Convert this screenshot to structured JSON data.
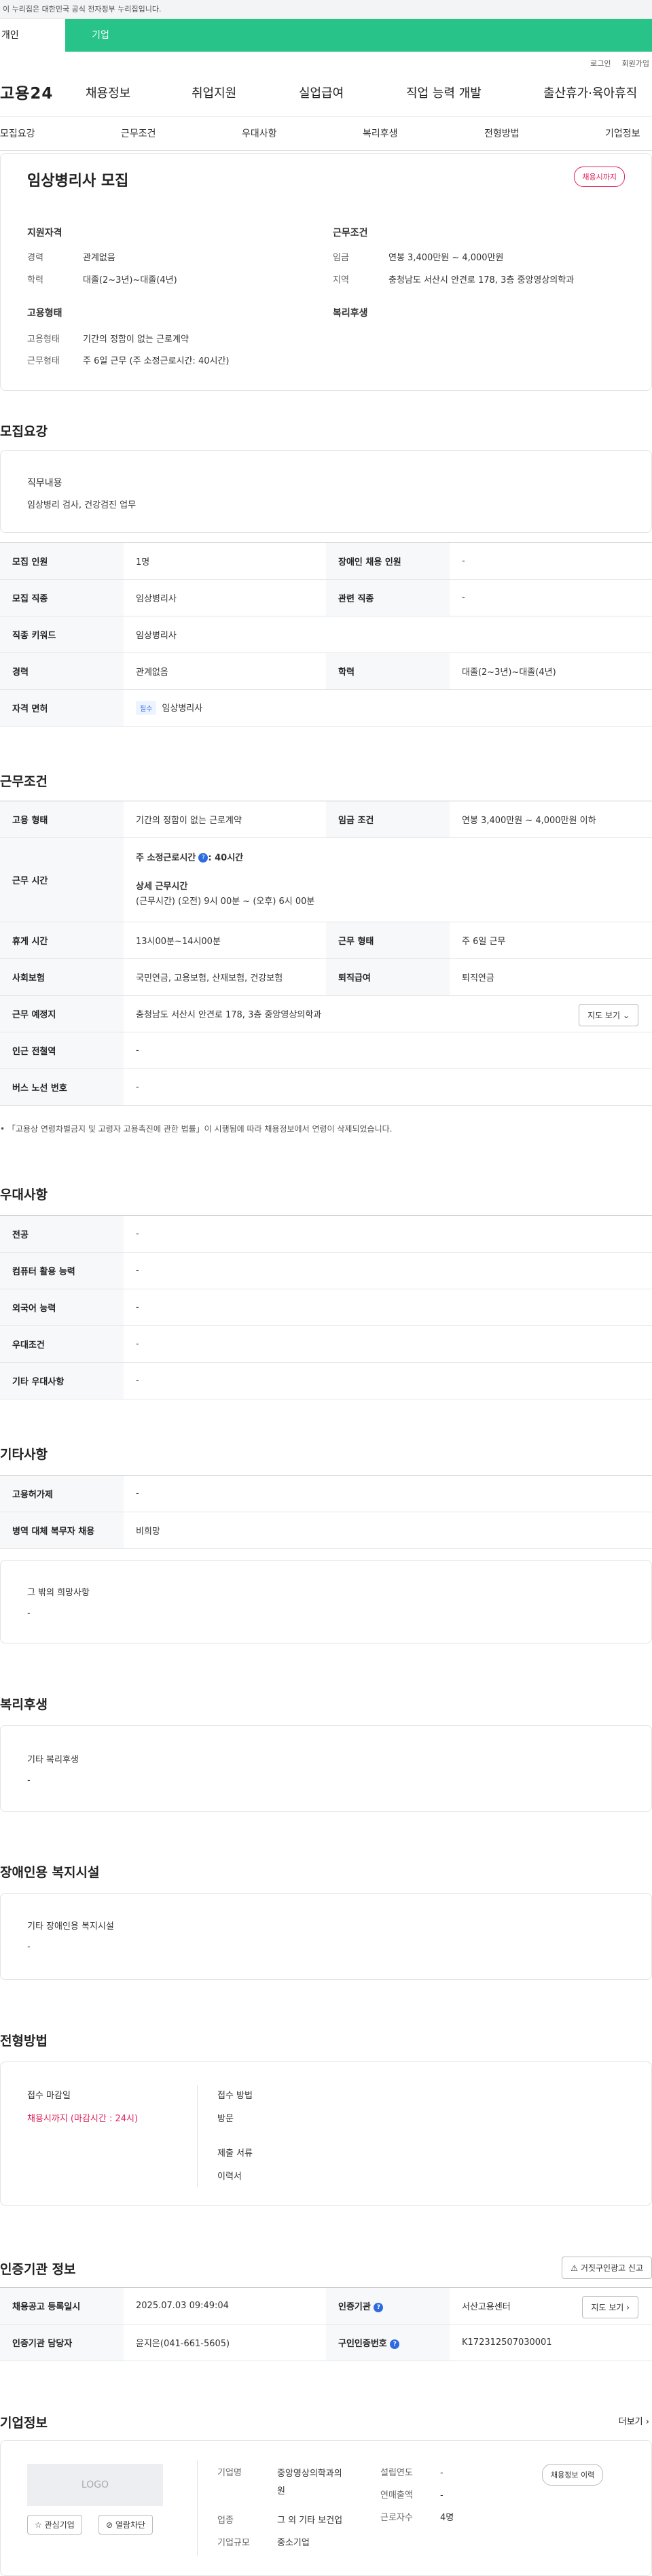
{
  "gov_banner": "이 누리집은 대한민국 공식 전자정부 누리집입니다.",
  "switch": {
    "personal": "개인",
    "company": "기업"
  },
  "util": {
    "login": "로그인",
    "join": "회원가입"
  },
  "logo": "고용24",
  "gnb": [
    "채용정보",
    "취업지원",
    "실업급여",
    "직업 능력 개발",
    "출산휴가·육아휴직"
  ],
  "tabs": [
    "모집요강",
    "근무조건",
    "우대사항",
    "복리후생",
    "전형방법",
    "기업정보"
  ],
  "summary": {
    "title": "임상병리사 모집",
    "badge": "채용시까지",
    "apply_head": "지원자격",
    "cond_head": "근무조건",
    "emp_head": "고용형태",
    "welfare_head": "복리후생",
    "career_k": "경력",
    "career_v": "관계없음",
    "edu_k": "학력",
    "edu_v": "대졸(2~3년)~대졸(4년)",
    "wage_k": "임금",
    "wage_v": "연봉 3,400만원 ~ 4,000만원",
    "area_k": "지역",
    "area_v": "충청남도 서산시 안견로 178, 3층 중앙영상의학과",
    "etype_k": "고용형태",
    "etype_v": "기간의 정함이 없는 근로계약",
    "work_k": "근무형태",
    "work_v": "주 6일 근무 (주 소정근로시간: 40시간)"
  },
  "recruit": {
    "title": "모집요강",
    "job_k": "직무내용",
    "job_v": "임상병리 검사, 건강검진 업무",
    "rows": {
      "people_k": "모집 인원",
      "people_v": "1명",
      "disabled_k": "장애인 채용 인원",
      "disabled_v": "-",
      "type_k": "모집 직종",
      "type_v": "임상병리사",
      "rel_k": "관련 직종",
      "rel_v": "-",
      "kw_k": "직종 키워드",
      "kw_v": "임상병리사",
      "career_k": "경력",
      "career_v": "관계없음",
      "edu_k": "학력",
      "edu_v": "대졸(2~3년)~대졸(4년)",
      "license_k": "자격 면허",
      "license_chip": "필수",
      "license_v": "임상병리사"
    }
  },
  "conditions": {
    "title": "근무조건",
    "etype_k": "고용 형태",
    "etype_v": "기간의 정함이 없는 근로계약",
    "wage_k": "임금 조건",
    "wage_v": "연봉 3,400만원 ~ 4,000만원 이하",
    "hours_k": "근무 시간",
    "hours_week": "주 소정근로시간",
    "hours_week_v": ": 40시간",
    "detail_head": "상세 근무시간",
    "detail_v": "(근무시간) (오전) 9시 00분 ~ (오후) 6시 00분",
    "break_k": "휴게 시간",
    "break_v": "13시00분~14시00분",
    "work_k": "근무 형태",
    "work_v": "주 6일 근무",
    "ins_k": "사회보험",
    "ins_v": "국민연금, 고용보험, 산재보험, 건강보험",
    "ret_k": "퇴직급여",
    "ret_v": "퇴직연금",
    "place_k": "근무 예정지",
    "place_v": "충청남도 서산시 안견로 178, 3층 중앙영상의학과",
    "map_btn": "지도 보기",
    "subway_k": "인근 전철역",
    "subway_v": "-",
    "bus_k": "버스 노선 번호",
    "bus_v": "-",
    "note": "「고용상 연령차별금지 및 고령자 고용촉진에 관한 법률」이 시행됨에 따라 채용정보에서 연령이 삭제되었습니다."
  },
  "pref": {
    "title": "우대사항",
    "major_k": "전공",
    "major_v": "-",
    "pc_k": "컴퓨터 활용 능력",
    "pc_v": "-",
    "lang_k": "외국어 능력",
    "lang_v": "-",
    "cond_k": "우대조건",
    "cond_v": "-",
    "etc_k": "기타 우대사항",
    "etc_v": "-"
  },
  "other": {
    "title": "기타사항",
    "hire_k": "고용허가제",
    "hire_v": "-",
    "mil_k": "병역 대체 복무자 채용",
    "mil_v": "비희망",
    "wish_head": "그 밖의 희망사항",
    "wish_v": "-"
  },
  "welfare": {
    "title": "복리후생",
    "head": "기타 복리후생",
    "v": "-"
  },
  "disabled": {
    "title": "장애인용 복지시설",
    "head": "기타 장애인용 복지시설",
    "v": "-"
  },
  "process": {
    "title": "전형방법",
    "deadline_head": "접수 마감일",
    "deadline_v": "채용시까지 (마감시간 : 24시)",
    "method_head": "접수 방법",
    "method_v": "방문",
    "docs_head": "제출 서류",
    "docs_v": "이력서"
  },
  "cert": {
    "title": "인증기관 정보",
    "report_btn": "거짓구인광고 신고",
    "reg_k": "채용공고 등록일시",
    "reg_v": "2025.07.03 09:49:04",
    "org_k": "인증기관",
    "org_v": "서산고용센터",
    "map_btn": "지도 보기",
    "mgr_k": "인증기관 담당자",
    "mgr_v": "윤지은(041-661-5605)",
    "no_k": "구인인증번호",
    "no_v": "K172312507030001"
  },
  "company": {
    "title": "기업정보",
    "more": "더보기",
    "logo": "LOGO",
    "fav": "관심기업",
    "block": "열람차단",
    "history_btn": "채용정보 이력",
    "name_k": "기업명",
    "name_v1": "중앙영상의학과의",
    "name_v2": "원",
    "ind_k": "업종",
    "ind_v": "그 외 기타 보건업",
    "size_k": "기업규모",
    "size_v": "중소기업",
    "year_k": "설립연도",
    "year_v": "-",
    "sales_k": "연매출액",
    "sales_v": "-",
    "emp_k": "근로자수",
    "emp_v": "4명"
  }
}
